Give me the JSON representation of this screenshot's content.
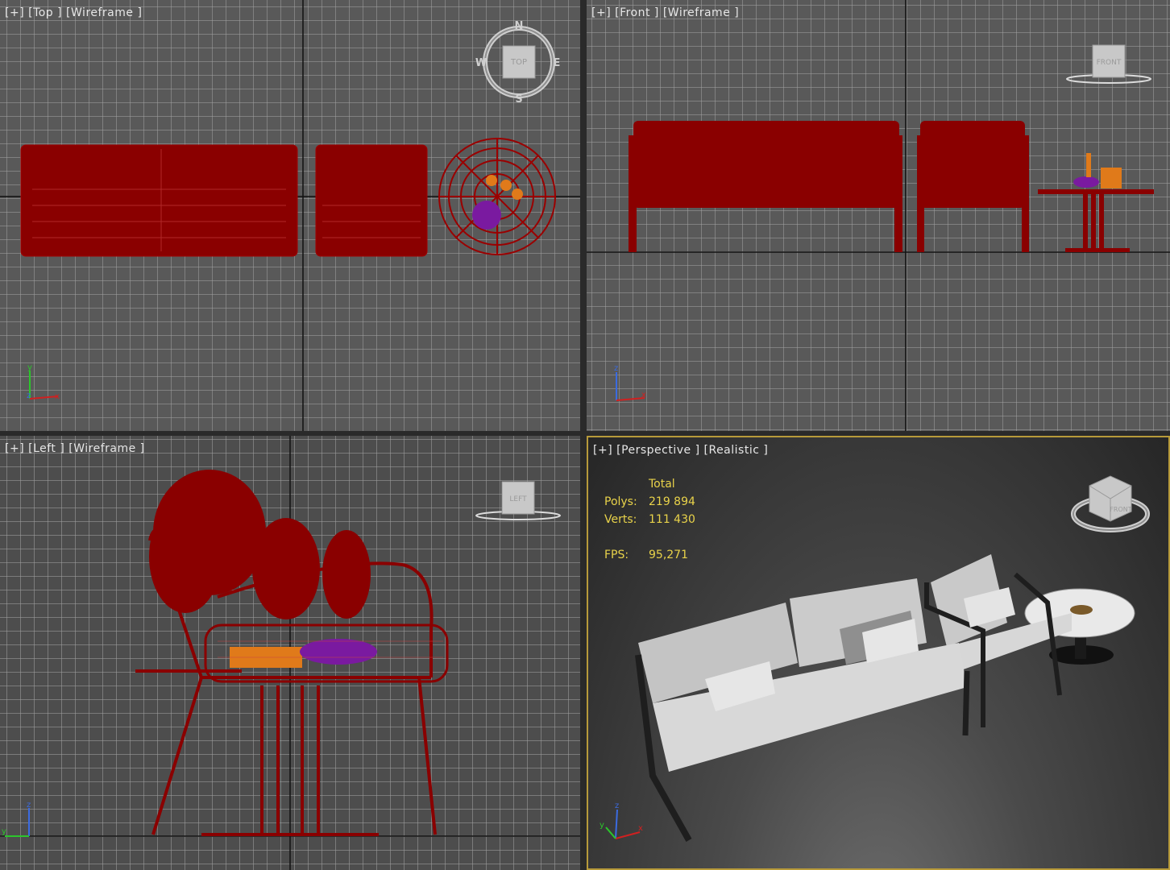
{
  "viewports": {
    "top": {
      "label": "[+] [Top ] [Wireframe ]",
      "cube": {
        "face": "TOP",
        "n": "N",
        "s": "S",
        "e": "E",
        "w": "W"
      }
    },
    "front": {
      "label": "[+] [Front ] [Wireframe ]",
      "cube": {
        "face": "FRONT"
      }
    },
    "left": {
      "label": "[+] [Left ] [Wireframe ]",
      "cube": {
        "face": "LEFT"
      }
    },
    "perspective": {
      "label": "[+] [Perspective ] [Realistic ]",
      "stats": {
        "header": "Total",
        "polys_label": "Polys:",
        "polys": "219 894",
        "verts_label": "Verts:",
        "verts": "111 430",
        "fps_label": "FPS:",
        "fps": "95,271"
      },
      "cube": {
        "face": "FRONT"
      }
    }
  },
  "axes": {
    "x": "x",
    "y": "y",
    "z": "z"
  },
  "colors": {
    "wireframe": "#8a0000",
    "stats": "#e9d34a",
    "active_border": "#b79a3a",
    "orange": "#e07a1a",
    "purple": "#7a1aa0"
  },
  "icons": [
    "viewcube-icon",
    "compass-icon",
    "axis-tripod-icon"
  ]
}
